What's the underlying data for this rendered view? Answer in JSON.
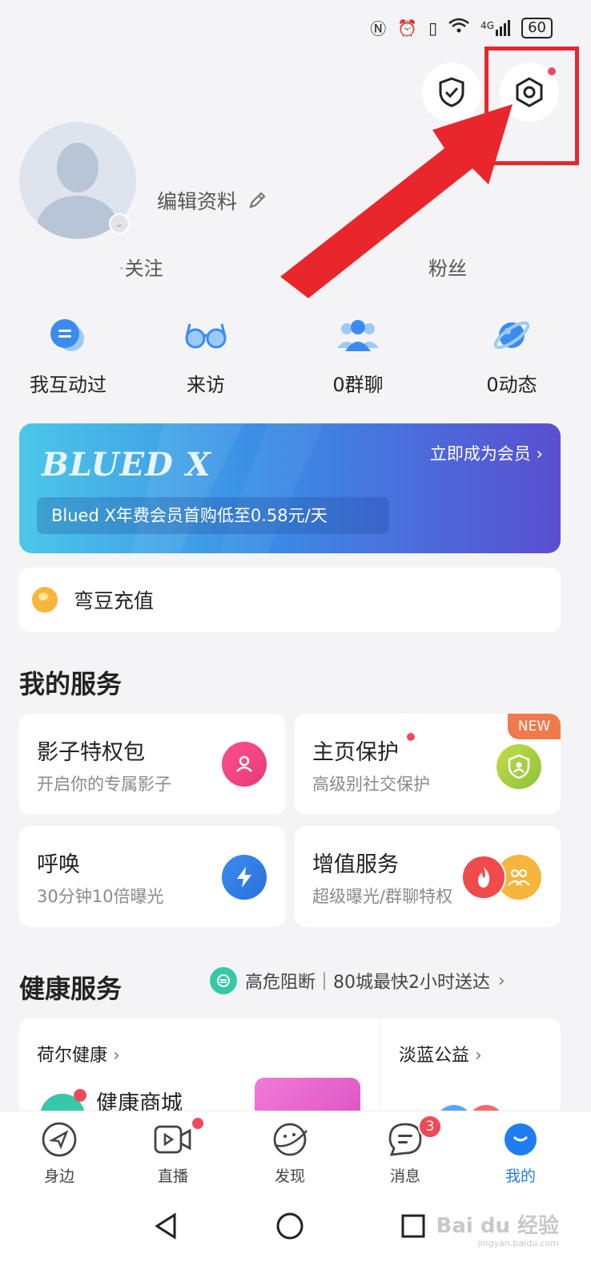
{
  "status_bar": {
    "battery": "60",
    "network": "4G"
  },
  "header": {
    "shield_icon": "shield-check-icon",
    "settings_icon": "hexagon-settings-icon"
  },
  "profile": {
    "edit_label": "编辑资料",
    "follow_label": "关注",
    "fans_label": "粉丝"
  },
  "quick_actions": [
    {
      "label": "我互动过",
      "icon": "chat-bubble-icon"
    },
    {
      "label": "来访",
      "icon": "glasses-icon"
    },
    {
      "label": "0群聊",
      "icon": "group-people-icon"
    },
    {
      "label": "0动态",
      "icon": "planet-icon"
    }
  ],
  "banner": {
    "brand": "BLUED X",
    "cta": "立即成为会员",
    "desc": "Blued X年费会员首购低至0.58元/天"
  },
  "recharge": {
    "label": "弯豆充值"
  },
  "services": {
    "title": "我的服务",
    "cards": [
      {
        "title": "影子特权包",
        "subtitle": "开启你的专属影子"
      },
      {
        "title": "主页保护",
        "subtitle": "高级别社交保护",
        "tag": "NEW"
      },
      {
        "title": "呼唤",
        "subtitle": "30分钟10倍曝光"
      },
      {
        "title": "增值服务",
        "subtitle": "超级曝光/群聊特权"
      }
    ]
  },
  "health": {
    "title": "健康服务",
    "promo": "高危阻断｜80城最快2小时送达",
    "left_header": "荷尔健康",
    "left_item": "健康商城",
    "right_header": "淡蓝公益"
  },
  "tabbar": {
    "tabs": [
      {
        "label": "身边"
      },
      {
        "label": "直播"
      },
      {
        "label": "发现"
      },
      {
        "label": "消息",
        "badge": "3"
      },
      {
        "label": "我的"
      }
    ],
    "active_color": "#1f7df0"
  },
  "watermark": {
    "text": "Bai du 经验",
    "url_text": "jingyan.baidu.com"
  }
}
